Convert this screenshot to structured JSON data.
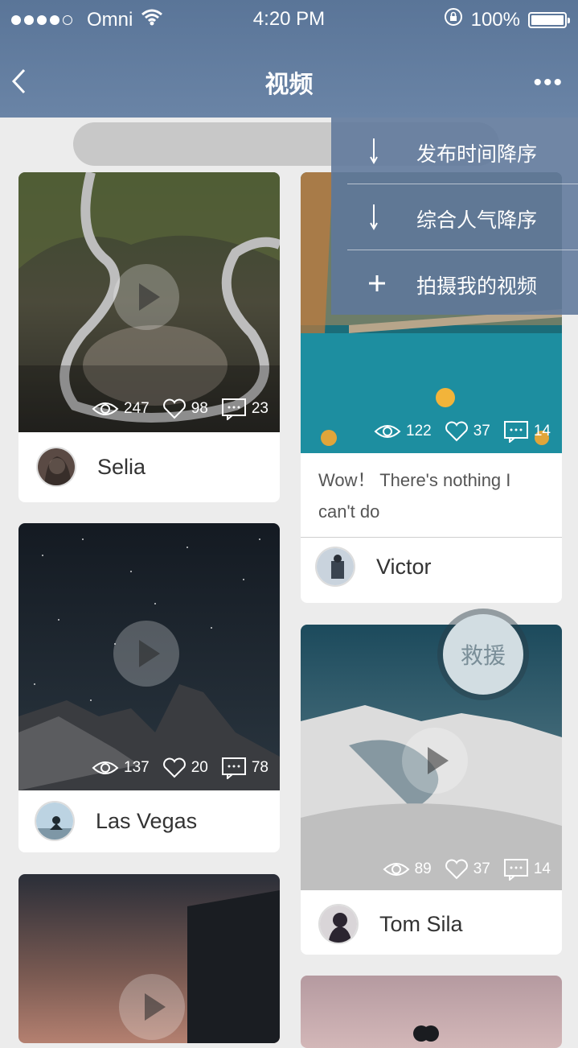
{
  "status_bar": {
    "carrier": "Omni",
    "time": "4:20 PM",
    "battery": "100%",
    "battery_level": 1.0
  },
  "nav": {
    "title": "视频",
    "more": "•••"
  },
  "search": {
    "placeholder": ""
  },
  "menu": {
    "items": [
      {
        "icon": "arrow-down-icon",
        "label": "发布时间降序"
      },
      {
        "icon": "arrow-down-icon",
        "label": "综合人气降序"
      },
      {
        "icon": "plus-icon",
        "label": "拍摄我的视频"
      }
    ]
  },
  "cards": [
    {
      "author": "Selia",
      "views": "247",
      "likes": "98",
      "comments": "23",
      "description": ""
    },
    {
      "author": "Victor",
      "views": "122",
      "likes": "37",
      "comments": "14",
      "description": "Wow！ There's nothing I can't do"
    },
    {
      "author": "Las Vegas",
      "views": "137",
      "likes": "20",
      "comments": "78",
      "description": ""
    },
    {
      "author": "Tom Sila",
      "views": "89",
      "likes": "37",
      "comments": "14",
      "description": ""
    }
  ],
  "rescue_button": {
    "label": "救援"
  }
}
